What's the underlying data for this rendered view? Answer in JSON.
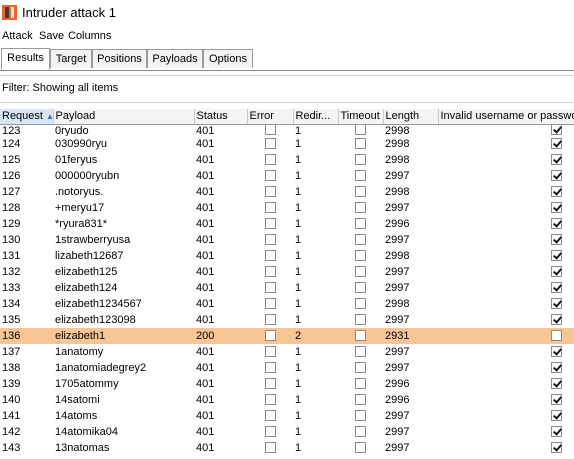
{
  "window": {
    "title": "Intruder attack 1",
    "icon": "burp-intruder-icon",
    "icon_colors": [
      "#e8662b",
      "#3b3b3b"
    ]
  },
  "menu": [
    "Attack",
    "Save",
    "Columns"
  ],
  "tabs": [
    {
      "label": "Results",
      "active": true
    },
    {
      "label": "Target",
      "active": false
    },
    {
      "label": "Positions",
      "active": false
    },
    {
      "label": "Payloads",
      "active": false
    },
    {
      "label": "Options",
      "active": false
    }
  ],
  "filter": {
    "text": "Filter: Showing all items"
  },
  "table": {
    "sorted_column": "Request",
    "sort_direction": "ascending",
    "highlight_color": "#f8c595",
    "columns": [
      "Request",
      "Payload",
      "Status",
      "Error",
      "Redir...",
      "Timeout",
      "Length",
      "Invalid username or password"
    ],
    "rows": [
      {
        "request": "123",
        "payload": "0ryudo",
        "status": "401",
        "error": false,
        "redir": "1",
        "timeout": false,
        "length": "2998",
        "invalid": true,
        "highlight": false
      },
      {
        "request": "124",
        "payload": "030990ryu",
        "status": "401",
        "error": false,
        "redir": "1",
        "timeout": false,
        "length": "2998",
        "invalid": true,
        "highlight": false
      },
      {
        "request": "125",
        "payload": "01feryus",
        "status": "401",
        "error": false,
        "redir": "1",
        "timeout": false,
        "length": "2998",
        "invalid": true,
        "highlight": false
      },
      {
        "request": "126",
        "payload": "000000ryubn",
        "status": "401",
        "error": false,
        "redir": "1",
        "timeout": false,
        "length": "2997",
        "invalid": true,
        "highlight": false
      },
      {
        "request": "127",
        "payload": ".notoryus.",
        "status": "401",
        "error": false,
        "redir": "1",
        "timeout": false,
        "length": "2998",
        "invalid": true,
        "highlight": false
      },
      {
        "request": "128",
        "payload": "+meryu17",
        "status": "401",
        "error": false,
        "redir": "1",
        "timeout": false,
        "length": "2997",
        "invalid": true,
        "highlight": false
      },
      {
        "request": "129",
        "payload": "*ryura831*",
        "status": "401",
        "error": false,
        "redir": "1",
        "timeout": false,
        "length": "2996",
        "invalid": true,
        "highlight": false
      },
      {
        "request": "130",
        "payload": "1strawberryusa",
        "status": "401",
        "error": false,
        "redir": "1",
        "timeout": false,
        "length": "2997",
        "invalid": true,
        "highlight": false
      },
      {
        "request": "131",
        "payload": "lizabeth12687",
        "status": "401",
        "error": false,
        "redir": "1",
        "timeout": false,
        "length": "2998",
        "invalid": true,
        "highlight": false
      },
      {
        "request": "132",
        "payload": "elizabeth125",
        "status": "401",
        "error": false,
        "redir": "1",
        "timeout": false,
        "length": "2997",
        "invalid": true,
        "highlight": false
      },
      {
        "request": "133",
        "payload": "elizabeth124",
        "status": "401",
        "error": false,
        "redir": "1",
        "timeout": false,
        "length": "2997",
        "invalid": true,
        "highlight": false
      },
      {
        "request": "134",
        "payload": "elizabeth1234567",
        "status": "401",
        "error": false,
        "redir": "1",
        "timeout": false,
        "length": "2998",
        "invalid": true,
        "highlight": false
      },
      {
        "request": "135",
        "payload": "elizabeth123098",
        "status": "401",
        "error": false,
        "redir": "1",
        "timeout": false,
        "length": "2997",
        "invalid": true,
        "highlight": false
      },
      {
        "request": "136",
        "payload": "elizabeth1",
        "status": "200",
        "error": false,
        "redir": "2",
        "timeout": false,
        "length": "2931",
        "invalid": false,
        "highlight": true
      },
      {
        "request": "137",
        "payload": "1anatomy",
        "status": "401",
        "error": false,
        "redir": "1",
        "timeout": false,
        "length": "2997",
        "invalid": true,
        "highlight": false
      },
      {
        "request": "138",
        "payload": "1anatomiadegrey2",
        "status": "401",
        "error": false,
        "redir": "1",
        "timeout": false,
        "length": "2997",
        "invalid": true,
        "highlight": false
      },
      {
        "request": "139",
        "payload": "1705atommy",
        "status": "401",
        "error": false,
        "redir": "1",
        "timeout": false,
        "length": "2996",
        "invalid": true,
        "highlight": false
      },
      {
        "request": "140",
        "payload": "14satomi",
        "status": "401",
        "error": false,
        "redir": "1",
        "timeout": false,
        "length": "2996",
        "invalid": true,
        "highlight": false
      },
      {
        "request": "141",
        "payload": "14atoms",
        "status": "401",
        "error": false,
        "redir": "1",
        "timeout": false,
        "length": "2997",
        "invalid": true,
        "highlight": false
      },
      {
        "request": "142",
        "payload": "14atomika04",
        "status": "401",
        "error": false,
        "redir": "1",
        "timeout": false,
        "length": "2997",
        "invalid": true,
        "highlight": false
      },
      {
        "request": "143",
        "payload": "13natomas",
        "status": "401",
        "error": false,
        "redir": "1",
        "timeout": false,
        "length": "2997",
        "invalid": true,
        "highlight": false
      }
    ]
  }
}
